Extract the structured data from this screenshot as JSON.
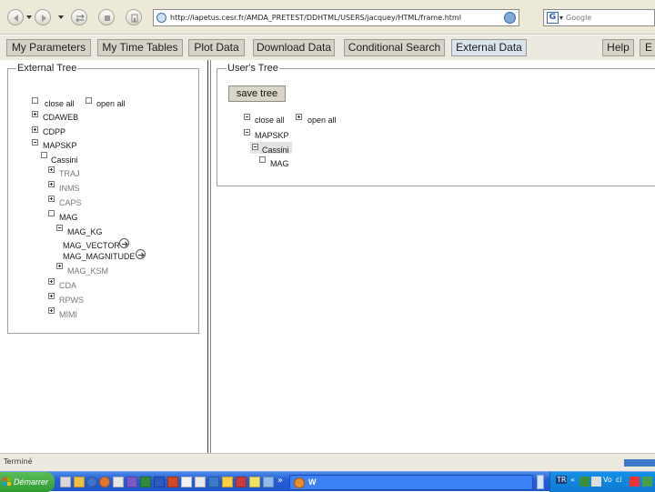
{
  "browser": {
    "url": "http://iapetus.cesr.fr/AMDA_PRETEST/DDHTML/USERS/jacquey/HTML/frame.html",
    "search_placeholder": "Google",
    "search_logo_letter": "G"
  },
  "tabs": [
    {
      "label": "My Parameters",
      "active": false
    },
    {
      "label": "My Time Tables",
      "active": false
    },
    {
      "label": "Plot Data",
      "active": false
    },
    {
      "label": "Download Data",
      "active": false
    },
    {
      "label": "Conditional Search",
      "active": false
    },
    {
      "label": "External Data",
      "active": true
    },
    {
      "label": "Help",
      "active": false
    },
    {
      "label": "E",
      "active": false
    }
  ],
  "external_tree": {
    "title": "External Tree",
    "close_all": "close all",
    "open_all": "open all",
    "nodes": {
      "cdaweb": "CDAWEB",
      "cdpp": "CDPP",
      "mapskp": "MAPSKP",
      "cassini": "Cassini",
      "traj": "TRAJ",
      "inms": "INMS",
      "caps": "CAPS",
      "mag": "MAG",
      "mag_krtp": "MAG_KG",
      "mag_vector": "MAG_VECTOR",
      "mag_magnitude": "MAG_MAGNITUDE",
      "mag_ksm": "MAG_KSM",
      "cda": "CDA",
      "rpws": "RPWS",
      "mimi": "MIMI"
    }
  },
  "user_tree": {
    "title": "User's Tree",
    "save_label": "save tree",
    "close_all": "close all",
    "open_all": "open all",
    "nodes": {
      "mapskp": "MAPSKP",
      "cassini": "Cassini",
      "mag": "MAG"
    }
  },
  "status": {
    "text": "Terminé",
    "progress": 1.0
  },
  "taskbar": {
    "start_label": "Démarrer",
    "task_label": "W",
    "overflow_marker": "»",
    "tray_labels": [
      "TR",
      "«",
      "Vo",
      "ci"
    ]
  },
  "colors": {
    "taskbar_blue": "#245edb",
    "start_green": "#2f9a2f",
    "active_tab": "#d9e4ee"
  },
  "icons": [
    "back-icon",
    "forward-icon",
    "reload-icon",
    "stop-icon",
    "home-icon",
    "go-icon",
    "google-icon",
    "arrow-icon"
  ]
}
